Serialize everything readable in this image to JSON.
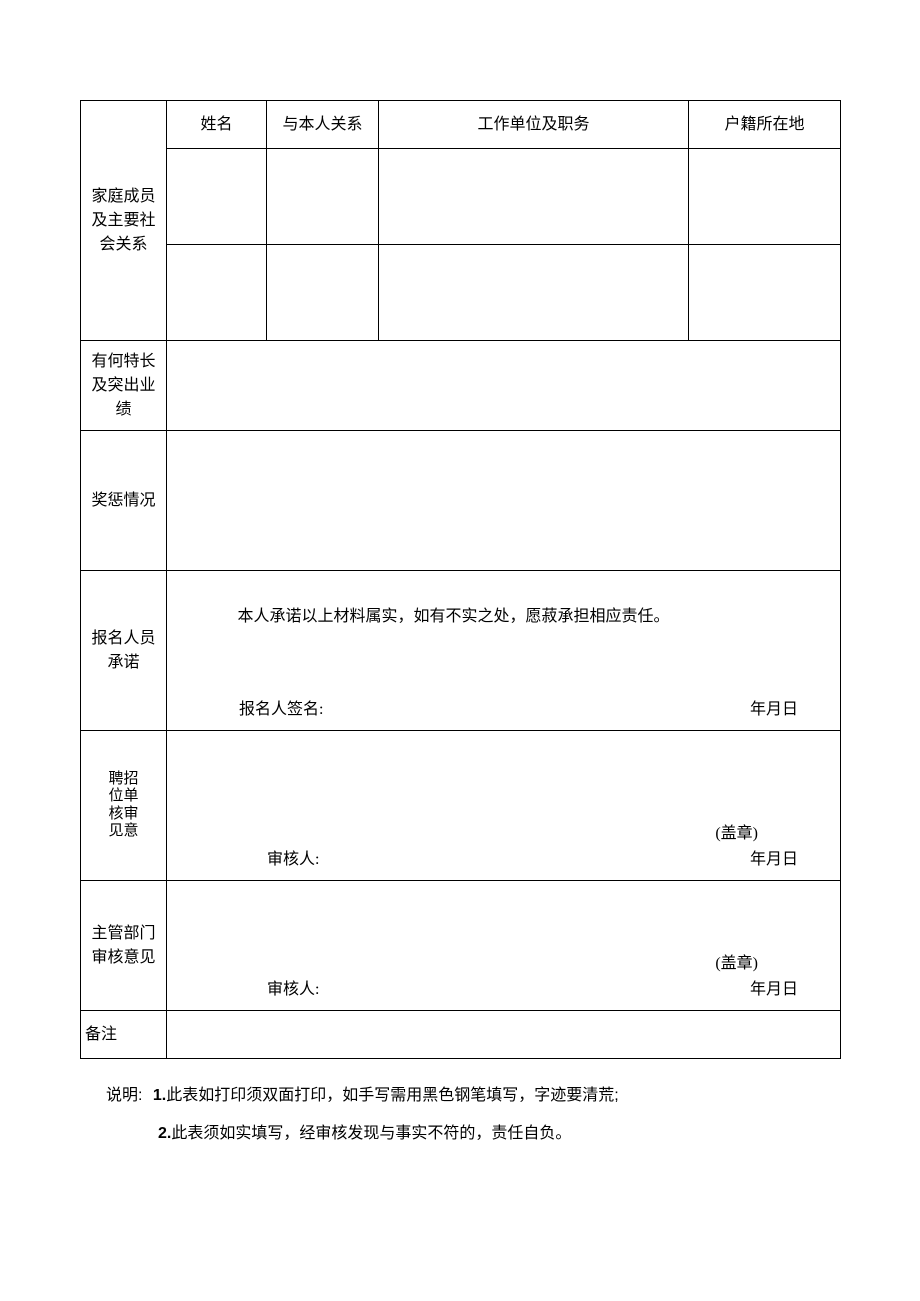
{
  "family": {
    "section_label_l1": "家庭成员",
    "section_label_l2": "及主要社",
    "section_label_l3": "会关系",
    "headers": {
      "name": "姓名",
      "relation": "与本人关系",
      "workplace": "工作单位及职务",
      "residence": "户籍所在地"
    },
    "rows": [
      {
        "name": "",
        "relation": "",
        "workplace": "",
        "residence": ""
      },
      {
        "name": "",
        "relation": "",
        "workplace": "",
        "residence": ""
      }
    ]
  },
  "specialty": {
    "label_l1": "有何特长",
    "label_l2": "及突出业",
    "label_l3": "绩",
    "value": ""
  },
  "reward": {
    "label": "奖惩情况",
    "value": ""
  },
  "promise": {
    "label_l1": "报名人员",
    "label_l2": "承诺",
    "statement": "本人承诺以上材料属实，如有不实之处，愿菽承担相应责任。",
    "sign_label": "报名人签名:",
    "date_label": "年月日"
  },
  "recruit_review": {
    "label_cols": [
      "招聘单位",
      "审核意见"
    ],
    "label_pairs": [
      [
        "聘",
        "招"
      ],
      [
        "位",
        "单"
      ],
      [
        "核",
        "审"
      ],
      [
        "见",
        "意"
      ]
    ],
    "stamp": "(盖章)",
    "reviewer_label": "审核人:",
    "date_label": "年月日"
  },
  "dept_review": {
    "label_l1": "主管部门",
    "label_l2": "审核意见",
    "stamp": "(盖章)",
    "reviewer_label": "审核人:",
    "date_label": "年月日"
  },
  "remark": {
    "label": "备注",
    "value": ""
  },
  "notes": {
    "prefix": "说明:",
    "item1_num": "1.",
    "item1_text": "此表如打印须双面打印，如手写需用黑色钢笔填写，字迹要清荒;",
    "item2_num": "2.",
    "item2_text": "此表须如实填写，经审核发现与事实不符的，责任自负。"
  }
}
